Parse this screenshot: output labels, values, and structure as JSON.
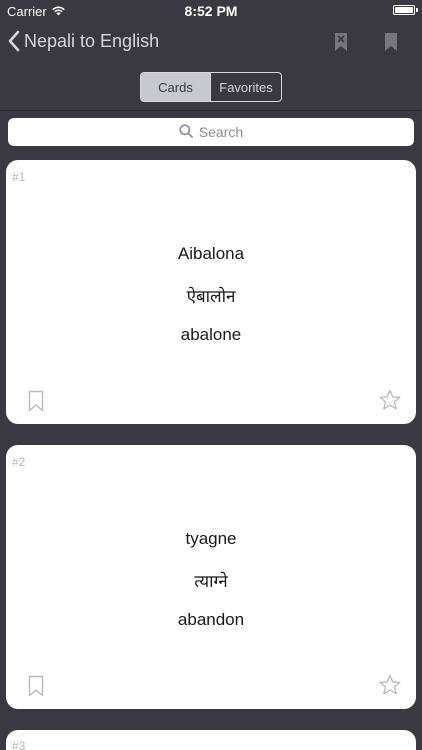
{
  "status_bar": {
    "carrier": "Carrier",
    "time": "8:52 PM",
    "battery_level": 1.0
  },
  "nav": {
    "back_label": "Nepali to English",
    "icons": [
      "bookmark-x-icon",
      "bookmark-icon"
    ]
  },
  "segments": {
    "cards_label": "Cards",
    "favorites_label": "Favorites",
    "selected": "Cards"
  },
  "search": {
    "placeholder": "Search"
  },
  "cards": [
    {
      "number": "#1",
      "romanized": "Aibalona",
      "nepali": "ऐबालोन",
      "english": "abalone"
    },
    {
      "number": "#2",
      "romanized": "tyagne",
      "nepali": "त्याग्ने",
      "english": "abandon"
    },
    {
      "number": "#3"
    }
  ],
  "colors": {
    "background": "#3a3840",
    "card": "#ffffff",
    "icon_gray": "#b8b8be"
  }
}
